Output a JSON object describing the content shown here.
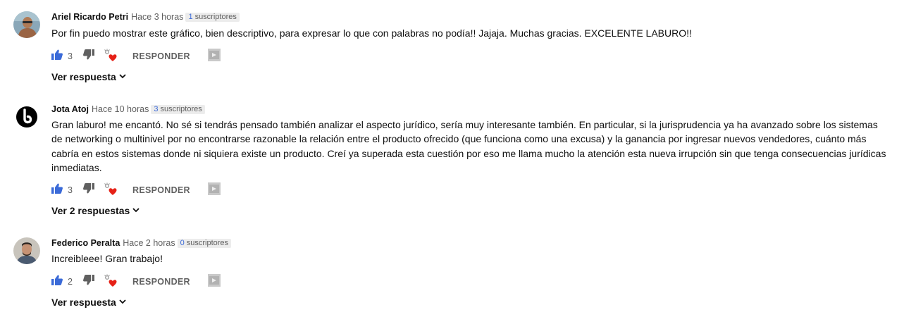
{
  "comments": [
    {
      "author": "Ariel Ricardo Petri",
      "time": "Hace 3 horas",
      "subscribers_count": "1",
      "subscribers_label": "suscriptores",
      "text": "Por fin puedo mostrar este gráfico, bien descriptivo, para expresar lo que con palabras no podía!! Jajaja. Muchas gracias. EXCELENTE LABURO!!",
      "likes": "3",
      "reply_label": "RESPONDER",
      "replies_label": "Ver respuesta"
    },
    {
      "author": "Jota Atoj",
      "time": "Hace 10 horas",
      "subscribers_count": "3",
      "subscribers_label": "suscriptores",
      "text": "Gran laburo! me encantó. No sé si tendrás pensado también analizar el aspecto jurídico, sería muy interesante también. En particular, si la jurisprudencia ya ha avanzado sobre los sistemas de networking o multinivel por no encontrarse razonable la relación entre el producto ofrecido (que funciona como una excusa) y la ganancia por ingresar nuevos vendedores, cuánto más cabría en estos sistemas donde ni siquiera existe un producto. Creí ya superada esta cuestión por eso me llama mucho la atención esta nueva irrupción sin que tenga consecuencias jurídicas inmediatas.",
      "likes": "3",
      "reply_label": "RESPONDER",
      "replies_label": "Ver 2 respuestas"
    },
    {
      "author": "Federico Peralta",
      "time": "Hace 2 horas",
      "subscribers_count": "0",
      "subscribers_label": "suscriptores",
      "text": "Increibleee! Gran trabajo!",
      "likes": "2",
      "reply_label": "RESPONDER",
      "replies_label": "Ver respuesta"
    }
  ],
  "colors": {
    "like_blue": "#3a6ad8",
    "heart_red": "#e62117",
    "muted": "#606060",
    "badge_bg": "#ececec"
  },
  "icons": [
    "thumbs-up-icon",
    "thumbs-down-icon",
    "creator-heart-icon",
    "chevron-down-icon",
    "extension-icon"
  ]
}
